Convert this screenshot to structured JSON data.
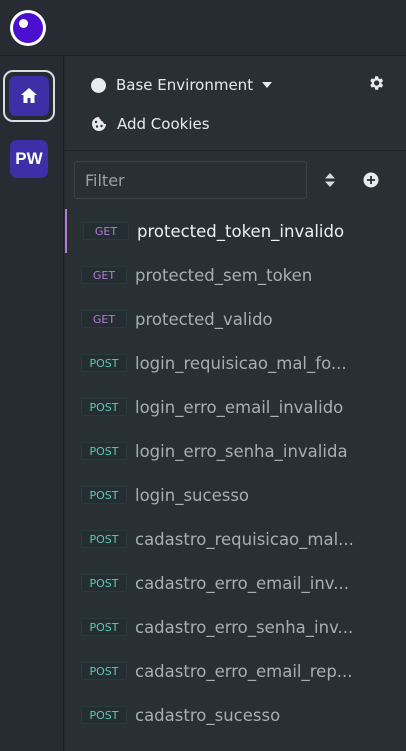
{
  "environment": {
    "label": "Base Environment"
  },
  "cookies": {
    "label": "Add Cookies"
  },
  "rail": {
    "pw_label": "PW"
  },
  "filter": {
    "placeholder": "Filter"
  },
  "requests": [
    {
      "method": "GET",
      "name": "protected_token_invalido",
      "active": true
    },
    {
      "method": "GET",
      "name": "protected_sem_token"
    },
    {
      "method": "GET",
      "name": "protected_valido"
    },
    {
      "method": "POST",
      "name": "login_requisicao_mal_fo..."
    },
    {
      "method": "POST",
      "name": "login_erro_email_invalido"
    },
    {
      "method": "POST",
      "name": "login_erro_senha_invalida"
    },
    {
      "method": "POST",
      "name": "login_sucesso"
    },
    {
      "method": "POST",
      "name": "cadastro_requisicao_mal..."
    },
    {
      "method": "POST",
      "name": "cadastro_erro_email_inv..."
    },
    {
      "method": "POST",
      "name": "cadastro_erro_senha_inv..."
    },
    {
      "method": "POST",
      "name": "cadastro_erro_email_rep..."
    },
    {
      "method": "POST",
      "name": "cadastro_sucesso"
    }
  ],
  "colors": {
    "get": "#b57bd6",
    "post": "#5fc9b5",
    "accent": "#4b0fd0",
    "workspace": "#3e2fa7"
  },
  "icons": [
    "app-logo-icon",
    "home-icon",
    "gear-icon",
    "cookie-icon",
    "sort-icon",
    "add-circle-icon"
  ]
}
